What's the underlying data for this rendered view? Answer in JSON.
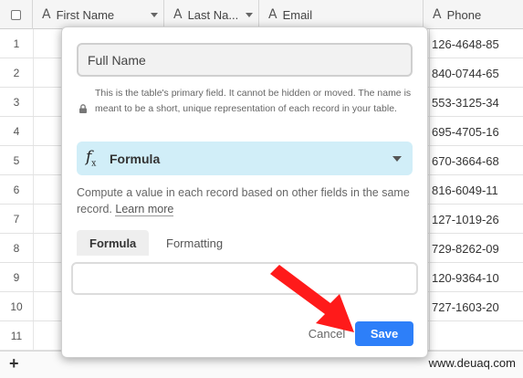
{
  "grid": {
    "columns": [
      {
        "icon": "text-field-icon",
        "glyph": "A",
        "label": "First Name"
      },
      {
        "icon": "text-field-icon",
        "glyph": "A",
        "label": "Last Na..."
      },
      {
        "icon": "text-field-icon",
        "glyph": "A",
        "label": "Email"
      },
      {
        "icon": "text-field-icon",
        "glyph": "A",
        "label": "Phone"
      }
    ],
    "rows": [
      {
        "num": "1",
        "phone": "126-4648-85"
      },
      {
        "num": "2",
        "phone": "840-0744-65"
      },
      {
        "num": "3",
        "phone": "553-3125-34"
      },
      {
        "num": "4",
        "phone": "695-4705-16"
      },
      {
        "num": "5",
        "phone": "670-3664-68"
      },
      {
        "num": "6",
        "phone": "816-6049-11"
      },
      {
        "num": "7",
        "phone": "127-1019-26"
      },
      {
        "num": "8",
        "phone": "729-8262-09"
      },
      {
        "num": "9",
        "phone": "120-9364-10"
      },
      {
        "num": "10",
        "phone": "727-1603-20"
      },
      {
        "num": "11",
        "phone": ""
      }
    ],
    "add_row_glyph": "+",
    "watermark": "www.deuaq.com"
  },
  "modal": {
    "field_name": "Full Name",
    "primary_note": "This is the table's primary field. It cannot be hidden or moved. The name is meant to be a short, unique representation of each record in your table.",
    "field_type": "Formula",
    "description": "Compute a value in each record based on other fields in the same record.",
    "learn_more": "Learn more",
    "tabs": [
      "Formula",
      "Formatting"
    ],
    "formula_value": "",
    "cancel_label": "Cancel",
    "save_label": "Save"
  },
  "colors": {
    "save_button": "#2d7ff9",
    "type_select_bg": "#d1eef8",
    "annotation_arrow": "#ff1a1a"
  }
}
